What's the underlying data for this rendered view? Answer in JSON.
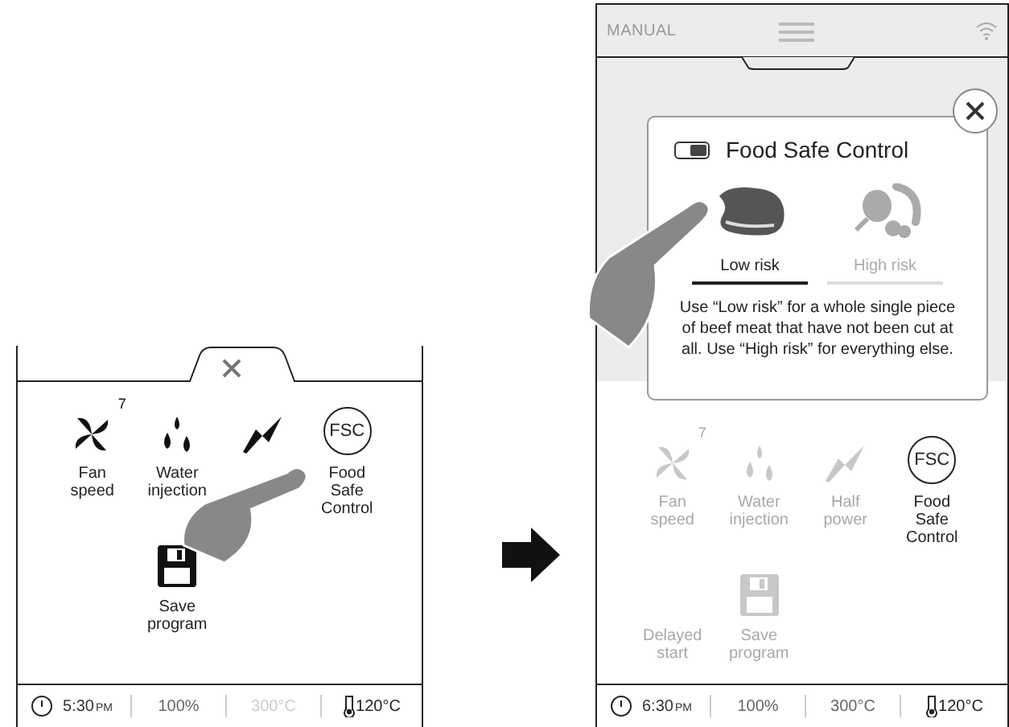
{
  "screens": [
    {
      "kind": "menu",
      "items": [
        {
          "kind": "tile",
          "label": "Fan speed",
          "badge": "7",
          "disabled": false
        },
        {
          "kind": "tile",
          "label": "Water injection",
          "disabled": false
        },
        {
          "kind": "tile",
          "disabled": false
        },
        {
          "kind": "tile",
          "icon_text": "FSC",
          "label": "Food Safe Control",
          "disabled": false
        },
        {
          "kind": "spacer"
        },
        {
          "kind": "tile",
          "label": "Save program",
          "disabled": false
        }
      ],
      "status": {
        "time": "5:30",
        "period": "PM",
        "power": "100%",
        "temperature": "300°C",
        "temperature_dimmed": true,
        "core_temperature": "120°C"
      }
    },
    {
      "kind": "dialog",
      "mode": "MANUAL",
      "dialog": {
        "toggle_on": true,
        "title": "Food Safe Control",
        "options": [
          {
            "label": "Low risk",
            "selected": true
          },
          {
            "label": "High risk",
            "selected": false
          }
        ],
        "description": "Use “Low risk” for a whole single piece of beef meat that have not been cut at all. Use “High risk” for everything else."
      },
      "items": [
        {
          "kind": "tile",
          "label": "Fan speed",
          "badge": "7",
          "disabled": true
        },
        {
          "kind": "tile",
          "label": "Water injection",
          "disabled": true
        },
        {
          "kind": "tile",
          "label": "Half power",
          "disabled": true
        },
        {
          "kind": "tile",
          "icon_text": "FSC",
          "label": "Food Safe Control",
          "disabled": false
        },
        {
          "kind": "tile",
          "label": "Delayed start",
          "disabled": true
        },
        {
          "kind": "tile",
          "label": "Save program",
          "disabled": true
        }
      ],
      "status": {
        "time": "6:30",
        "period": "PM",
        "power": "100%",
        "temperature": "300°C",
        "temperature_dimmed": false,
        "core_temperature": "120°C"
      }
    }
  ]
}
